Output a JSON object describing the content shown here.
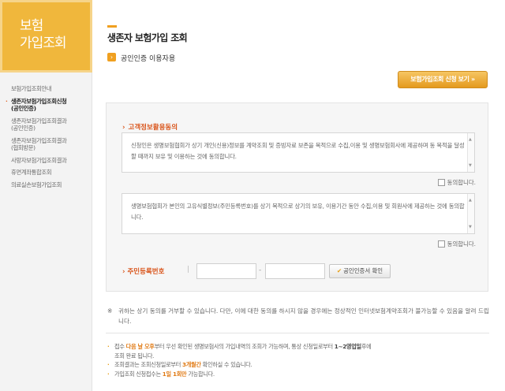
{
  "sidebar": {
    "banner_line1": "보험",
    "banner_line2": "가입조회",
    "items": [
      {
        "label": "보험가입조회안내"
      },
      {
        "label": "생존자보험가입조회신청",
        "label2": "(공인인증)"
      },
      {
        "label": "생존자보험가입조회결과",
        "label2": "(공인인증)"
      },
      {
        "label": "생존자보험가입조회결과",
        "label2": "(협회방문)"
      },
      {
        "label": "사망자보험가입조회결과"
      },
      {
        "label": "휴면계좌통합조회"
      },
      {
        "label": "의료실손보험가입조회"
      }
    ],
    "active_index": 1
  },
  "main": {
    "title": "생존자 보험가입 조회",
    "sub_title": "공인인증 이용자용",
    "apply_button": "보험가입조회 신청 보기 »"
  },
  "form": {
    "consent_title": "고객정보활용동의",
    "agree1_text": "신청인은 생명보험협회가 상기 개인(신용)정보를 계약조회 및 증빙자료 보존을 목적으로 수집,이용 및 생명보험회사에 제공하며 동 목적을 달성할 때까지 보유 및 이용하는 것에 동의합니다.",
    "agree1_label": "동의합니다.",
    "agree2_text": "생명보험협회가 본인의 고유식별정보(주민등록번호)를 상기 목적으로 상기의 보유, 이용기간 동안 수집,이용 및 회원사에 제공하는 것에 동의합니다.",
    "agree2_label": "동의합니다.",
    "rrn_label": "주민등록번호",
    "rrn_separator": "|",
    "rrn_dash": "-",
    "rrn_front_value": "",
    "rrn_back_value": "",
    "cert_button": "공인인증서 확인"
  },
  "notice": {
    "mark": "※",
    "text": "귀하는 상기 동의를 거부할 수 있습니다. 다만, 이에 대한 동의를 하시지 않을 경우에는 정상적인 인터넷보험계약조회가 불가능할 수 있음을 알려 드립니다."
  },
  "info": {
    "b1_pre": "접수 ",
    "b1_hl": "다음 날 오후",
    "b1_mid": "부터 우선 확인된 생명보험사의 가입내역의 조회가 가능하며, 통상 신청일로부터 ",
    "b1_bold": "1~2영업일",
    "b1_post": "후에",
    "b1_line2": "조회 완료 됩니다.",
    "b2_pre": "조회결과는 조회신청일로부터 ",
    "b2_hl": "3개월간",
    "b2_post": " 확인하실 수 있습니다.",
    "b3_pre": "가입조회 신청접수는 ",
    "b3_hl": "1일 1회만",
    "b3_post": " 가능합니다."
  },
  "colors": {
    "accent": "#f0b73c",
    "label_orange": "#d9541a",
    "highlight": "#e07a14"
  }
}
